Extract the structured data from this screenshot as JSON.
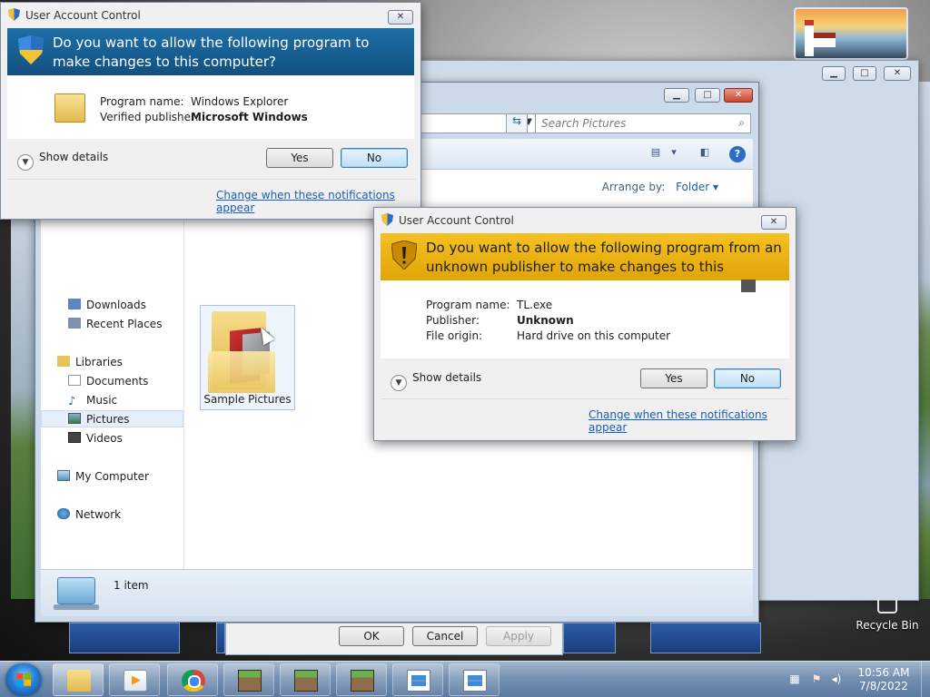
{
  "explorer": {
    "search_placeholder": "Search Pictures",
    "arrange_label": "Arrange by:",
    "arrange_value": "Folder",
    "nav": {
      "downloads": "Downloads",
      "recent": "Recent Places",
      "libraries": "Libraries",
      "documents": "Documents",
      "music": "Music",
      "pictures": "Pictures",
      "videos": "Videos",
      "computer": "My Computer",
      "network": "Network"
    },
    "folder_label": "Sample Pictures",
    "status_count": "1 item"
  },
  "uac1": {
    "title": "User Account Control",
    "question": "Do you want to allow the following program to make changes to this computer?",
    "program_name_label": "Program name:",
    "program_name": "Windows Explorer",
    "publisher_label": "Verified publisher:",
    "publisher": "Microsoft Windows",
    "show_details": "Show details",
    "yes": "Yes",
    "no": "No",
    "change_link": "Change when these notifications appear"
  },
  "uac2": {
    "title": "User Account Control",
    "question": "Do you want to allow the following program from an unknown publisher to make changes to this computer?",
    "program_name_label": "Program name:",
    "program_name": "TL.exe",
    "publisher_label": "Publisher:",
    "publisher": "Unknown",
    "origin_label": "File origin:",
    "origin": "Hard drive on this computer",
    "show_details": "Show details",
    "yes": "Yes",
    "no": "No",
    "change_link": "Change when these notifications appear"
  },
  "props_dialog": {
    "ok": "OK",
    "cancel": "Cancel",
    "apply": "Apply"
  },
  "desktop": {
    "recycle_bin": "Recycle Bin"
  },
  "taskbar": {
    "time": "10:56 AM",
    "date": "7/8/2022"
  },
  "colors": {
    "uac_blue": "#12507f",
    "uac_yellow": "#f6c023",
    "link": "#1a5fb4"
  }
}
